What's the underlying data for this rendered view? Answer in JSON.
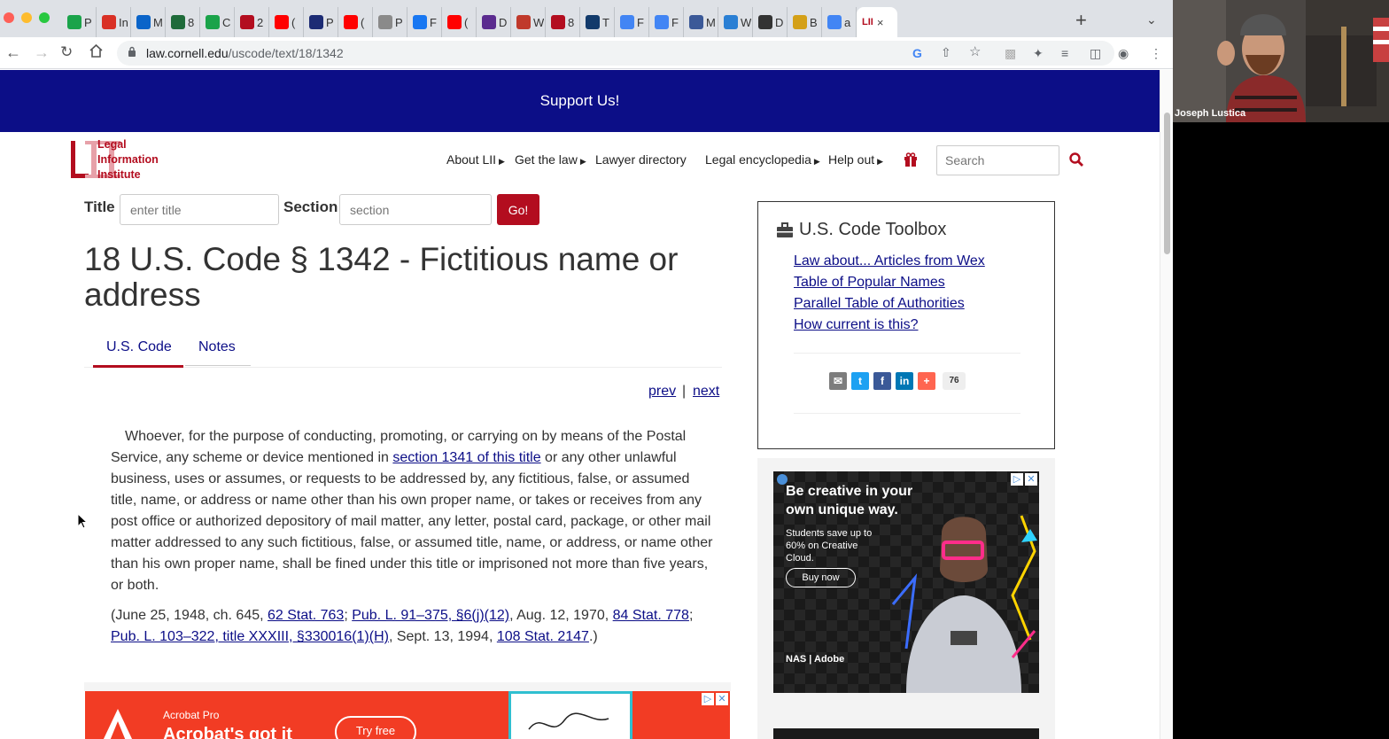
{
  "browser": {
    "tabs": [
      {
        "label": "P",
        "icon": "play-icon",
        "color": "#1aa34a"
      },
      {
        "label": "In",
        "icon": "gmail-icon",
        "color": "#d93025"
      },
      {
        "label": "M",
        "icon": "outlook-icon",
        "color": "#0a64c9"
      },
      {
        "label": "8",
        "icon": "leaf-icon",
        "color": "#1f6b3a"
      },
      {
        "label": "C",
        "icon": "play-icon",
        "color": "#1aa34a"
      },
      {
        "label": "2",
        "icon": "lii-icon",
        "color": "#b30d1f"
      },
      {
        "label": "(",
        "icon": "youtube-icon",
        "color": "#ff0000"
      },
      {
        "label": "P",
        "icon": "j-icon",
        "color": "#1c2b74"
      },
      {
        "label": "(",
        "icon": "youtube-icon",
        "color": "#ff0000"
      },
      {
        "label": "P",
        "icon": "plane-icon",
        "color": "#8a8a8a"
      },
      {
        "label": "F",
        "icon": "facebook-icon",
        "color": "#1877f2"
      },
      {
        "label": "(",
        "icon": "youtube-icon",
        "color": "#ff0000"
      },
      {
        "label": "D",
        "icon": "d-icon",
        "color": "#5b2b8f"
      },
      {
        "label": "W",
        "icon": "flag-icon",
        "color": "#c0392b"
      },
      {
        "label": "8",
        "icon": "lii-icon",
        "color": "#b30d1f"
      },
      {
        "label": "T",
        "icon": "n-icon",
        "color": "#123a6b"
      },
      {
        "label": "F",
        "icon": "google-icon",
        "color": "#4285f4"
      },
      {
        "label": "F",
        "icon": "google-icon",
        "color": "#4285f4"
      },
      {
        "label": "M",
        "icon": "doc-icon",
        "color": "#3b5998"
      },
      {
        "label": "W",
        "icon": "shield-icon",
        "color": "#2a7fd4"
      },
      {
        "label": "D",
        "icon": "wikipedia-icon",
        "color": "#333333"
      },
      {
        "label": "B",
        "icon": "sun-icon",
        "color": "#d4a017"
      },
      {
        "label": "a",
        "icon": "google-icon",
        "color": "#4285f4"
      }
    ],
    "active_tab": {
      "label": "LII",
      "close": "×"
    },
    "url_host": "law.cornell.edu",
    "url_path": "/uscode/text/18/1342"
  },
  "site": {
    "support_banner": "Support Us!",
    "logo_lines": [
      "Legal",
      "Information",
      "Institute"
    ],
    "nav": [
      "About LII",
      "Get the law",
      "Lawyer directory",
      "Legal encyclopedia",
      "Help out"
    ],
    "search_placeholder": "Search",
    "title_label": "Title",
    "title_placeholder": "enter title",
    "section_label": "Section",
    "section_placeholder": "section",
    "go_label": "Go!"
  },
  "document": {
    "heading": "18 U.S. Code § 1342 - Fictitious name or address",
    "tabs": [
      "U.S. Code",
      "Notes"
    ],
    "prev": "prev",
    "separator": "|",
    "next": "next",
    "para_before_link": "Whoever, for the purpose of conducting, promoting, or carrying on by means of the Postal Service, any scheme or device mentioned in ",
    "para_link": "section 1341 of this title",
    "para_after_link": " or any other unlawful business, uses or assumes, or requests to be addressed by, any fictitious, false, or assumed title, name, or address or name other than his own proper name, or takes or receives from any post office or authorized depository of mail matter, any letter, postal card, package, or other mail matter addressed to any such fictitious, false, or assumed title, name, or address, or name other than his own proper name, shall be fined under this title or imprisoned not more than five years, or both.",
    "cite_parts": [
      {
        "text": "(June 25, 1948, ch. 645, ",
        "link": false
      },
      {
        "text": "62 Stat. 763",
        "link": true
      },
      {
        "text": "; ",
        "link": false
      },
      {
        "text": "Pub. L. 91–375, §6(j)(12)",
        "link": true
      },
      {
        "text": ", Aug. 12, 1970, ",
        "link": false
      },
      {
        "text": "84 Stat. 778",
        "link": true
      },
      {
        "text": "; ",
        "link": false
      },
      {
        "text": "Pub. L. 103–322, title XXXIII, §330016(1)(H)",
        "link": true
      },
      {
        "text": ", Sept. 13, 1994, ",
        "link": false
      },
      {
        "text": "108 Stat. 2147",
        "link": true
      },
      {
        "text": ".)",
        "link": false
      }
    ]
  },
  "toolbox": {
    "heading": "U.S. Code Toolbox",
    "links": [
      "Law about... Articles from Wex",
      "Table of Popular Names",
      "Parallel Table of Authorities",
      "How current is this?"
    ],
    "share_count": "76"
  },
  "ads": {
    "acrobat_small": "Acrobat Pro",
    "acrobat_big": "Acrobat's got it",
    "acrobat_button": "Try free",
    "side_heading": "Be creative in your own unique way.",
    "side_sub": "Students save up to 60% on Creative Cloud.",
    "side_button": "Buy now",
    "side_logos": "NAS  |  Adobe"
  },
  "video": {
    "participant": "Joseph Lustica"
  },
  "colors": {
    "lii_red": "#b30d1f",
    "navy": "#0c0e87"
  }
}
